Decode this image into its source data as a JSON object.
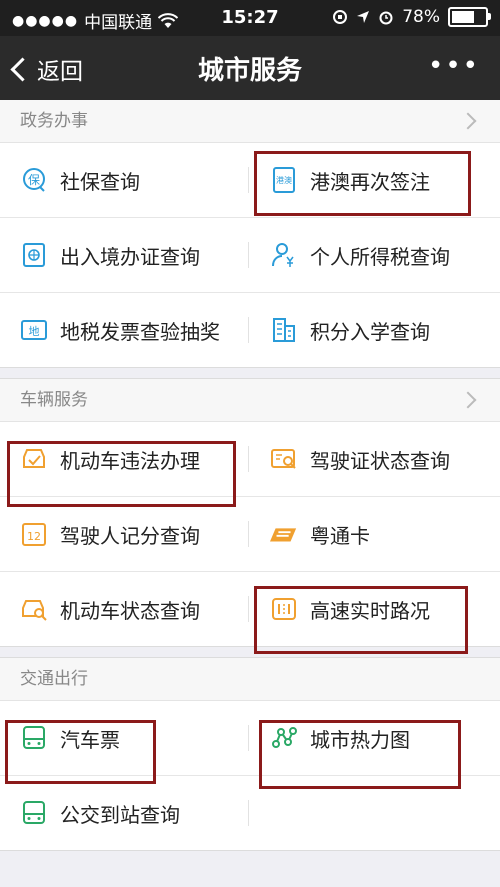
{
  "status": {
    "carrier": "中国联通",
    "time": "15:27",
    "battery": "78%",
    "battery_level": 0.78
  },
  "nav": {
    "back": "返回",
    "title": "城市服务",
    "more": "•••"
  },
  "sections": [
    {
      "header": "政务办事",
      "items": [
        [
          "社保查询",
          "港澳再次签注"
        ],
        [
          "出入境办证查询",
          "个人所得税查询"
        ],
        [
          "地税发票查验抽奖",
          "积分入学查询"
        ]
      ]
    },
    {
      "header": "车辆服务",
      "items": [
        [
          "机动车违法办理",
          "驾驶证状态查询"
        ],
        [
          "驾驶人记分查询",
          "粤通卡"
        ],
        [
          "机动车状态查询",
          "高速实时路况"
        ]
      ]
    },
    {
      "header": "交通出行",
      "items": [
        [
          "汽车票",
          "城市热力图"
        ],
        [
          "公交到站查询",
          ""
        ]
      ]
    }
  ],
  "icon_text": {
    "shebao": "保",
    "gangao": "港澳",
    "dishui": "地",
    "jifen12": "12"
  },
  "colors": {
    "blue": "#2a9bd8",
    "orange": "#f0a030",
    "green": "#2aa866",
    "highlight": "#8b1a1a"
  }
}
